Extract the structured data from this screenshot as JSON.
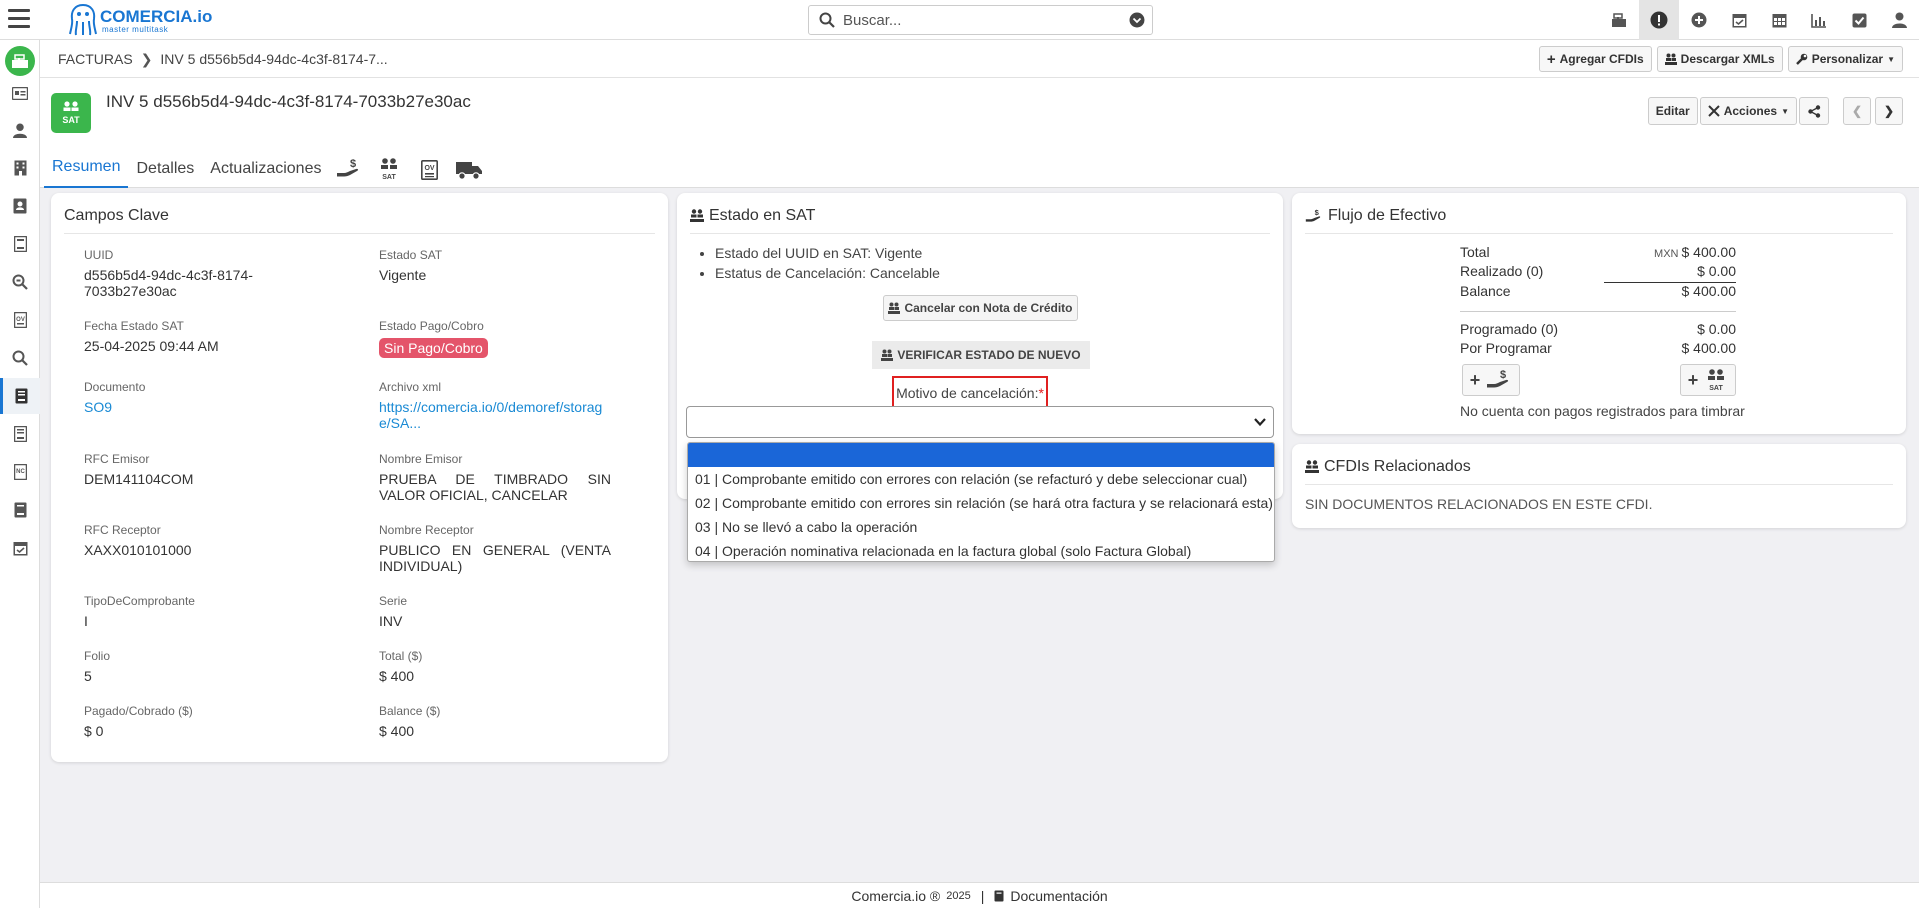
{
  "app": {
    "logo_name": "COMERCIA.io",
    "logo_tagline": "master multitask",
    "search_placeholder": "Buscar..."
  },
  "breadcrumb": {
    "root": "FACTURAS",
    "current": "INV 5 d556b5d4-94dc-4c3f-8174-7..."
  },
  "toolbar": {
    "add_cfdis": "Agregar CFDIs",
    "download_xmls": "Descargar XMLs",
    "customize": "Personalizar"
  },
  "header": {
    "badge": "SAT",
    "title": "INV 5 d556b5d4-94dc-4c3f-8174-7033b27e30ac",
    "edit": "Editar",
    "actions": "Acciones"
  },
  "tabs": [
    "Resumen",
    "Detalles",
    "Actualizaciones"
  ],
  "key_fields": {
    "title": "Campos Clave",
    "uuid_label": "UUID",
    "uuid_value": "d556b5d4-94dc-4c3f-8174-7033b27e30ac",
    "estado_sat_label": "Estado SAT",
    "estado_sat_value": "Vigente",
    "fecha_label": "Fecha Estado SAT",
    "fecha_value": "25-04-2025 09:44 AM",
    "pago_label": "Estado Pago/Cobro",
    "pago_value": "Sin Pago/Cobro",
    "documento_label": "Documento",
    "documento_value": "SO9",
    "xml_label": "Archivo xml",
    "xml_value": "https://comercia.io/0/demoref/storage/SA...",
    "rfc_emisor_label": "RFC Emisor",
    "rfc_emisor_value": "DEM141104COM",
    "nombre_emisor_label": "Nombre Emisor",
    "nombre_emisor_value": "PRUEBA DE TIMBRADO SIN VALOR OFICIAL, CANCELAR",
    "rfc_receptor_label": "RFC Receptor",
    "rfc_receptor_value": "XAXX010101000",
    "nombre_receptor_label": "Nombre Receptor",
    "nombre_receptor_value": "PUBLICO EN GENERAL (VENTA INDIVIDUAL)",
    "tipo_label": "TipoDeComprobante",
    "tipo_value": "I",
    "serie_label": "Serie",
    "serie_value": "INV",
    "folio_label": "Folio",
    "folio_value": "5",
    "total_label": "Total ($)",
    "total_value": "$ 400",
    "pagado_label": "Pagado/Cobrado ($)",
    "pagado_value": "$ 0",
    "balance_label": "Balance ($)",
    "balance_value": "$ 400"
  },
  "sat_status": {
    "title": "Estado en SAT",
    "uuid_state": "Estado del UUID en SAT: Vigente",
    "cancel_state": "Estatus de Cancelación: Cancelable",
    "credit_note_button": "Cancelar con Nota de Crédito",
    "verify_button": "VERIFICAR ESTADO DE NUEVO",
    "motivo_label": "Motivo de cancelación:",
    "required_mark": "*",
    "options": [
      "",
      "01 | Comprobante emitido con errores con relación (se refacturó y debe seleccionar cual)",
      "02 | Comprobante emitido con errores sin relación (se hará otra factura y se relacionará esta)",
      "03 | No se llevó a cabo la operación",
      "04 | Operación nominativa relacionada en la factura global (solo Factura Global)"
    ]
  },
  "cash_flow": {
    "title": "Flujo de Efectivo",
    "total_label": "Total",
    "currency": "MXN",
    "total_value": "$ 400.00",
    "realizado_label": "Realizado (0)",
    "realizado_value": "$ 0.00",
    "balance_label": "Balance",
    "balance_value": "$ 400.00",
    "programado_label": "Programado (0)",
    "programado_value": "$ 0.00",
    "por_programar_label": "Por Programar",
    "por_programar_value": "$ 400.00",
    "no_payments": "No cuenta con pagos registrados para timbrar"
  },
  "related": {
    "title": "CFDIs Relacionados",
    "empty": "SIN DOCUMENTOS RELACIONADOS EN ESTE CFDI."
  },
  "footer": {
    "brand": "Comercia.io ®",
    "year": "2025",
    "divider": "|",
    "docs": "Documentación"
  },
  "colors": {
    "accent": "#1976d2",
    "green": "#3bb64c",
    "danger": "#e4546a",
    "highlight_border": "#e02020",
    "selected_option": "#1a66d8"
  }
}
